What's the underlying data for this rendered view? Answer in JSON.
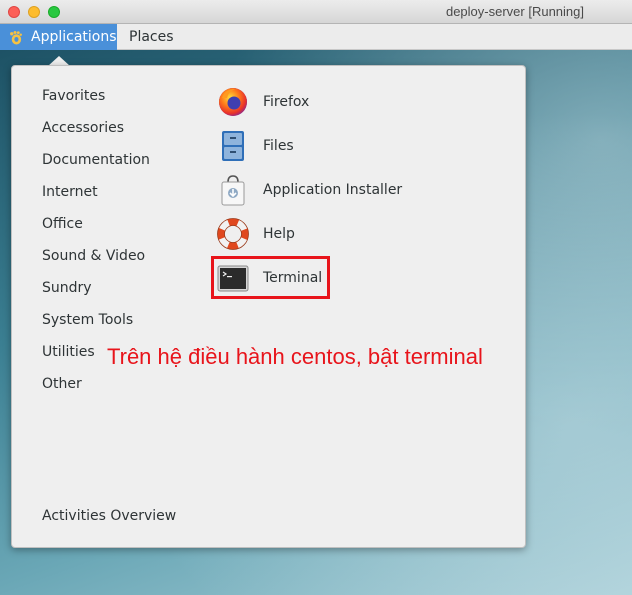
{
  "window": {
    "title": "deploy-server [Running]"
  },
  "panel": {
    "applications_label": "Applications",
    "places_label": "Places"
  },
  "menu": {
    "categories": [
      "Favorites",
      "Accessories",
      "Documentation",
      "Internet",
      "Office",
      "Sound & Video",
      "Sundry",
      "System Tools",
      "Utilities",
      "Other"
    ],
    "apps": [
      {
        "name": "Firefox",
        "icon": "firefox-icon"
      },
      {
        "name": "Files",
        "icon": "files-cabinet-icon"
      },
      {
        "name": "Application Installer",
        "icon": "software-bag-icon"
      },
      {
        "name": "Help",
        "icon": "lifebuoy-icon"
      },
      {
        "name": "Terminal",
        "icon": "terminal-icon"
      }
    ],
    "activities_label": "Activities Overview"
  },
  "annotation": {
    "text": "Trên hệ điều hành centos, bật terminal",
    "color": "#e8141b"
  },
  "colors": {
    "panel_active": "#4a90d9",
    "menu_bg": "#efefef"
  }
}
